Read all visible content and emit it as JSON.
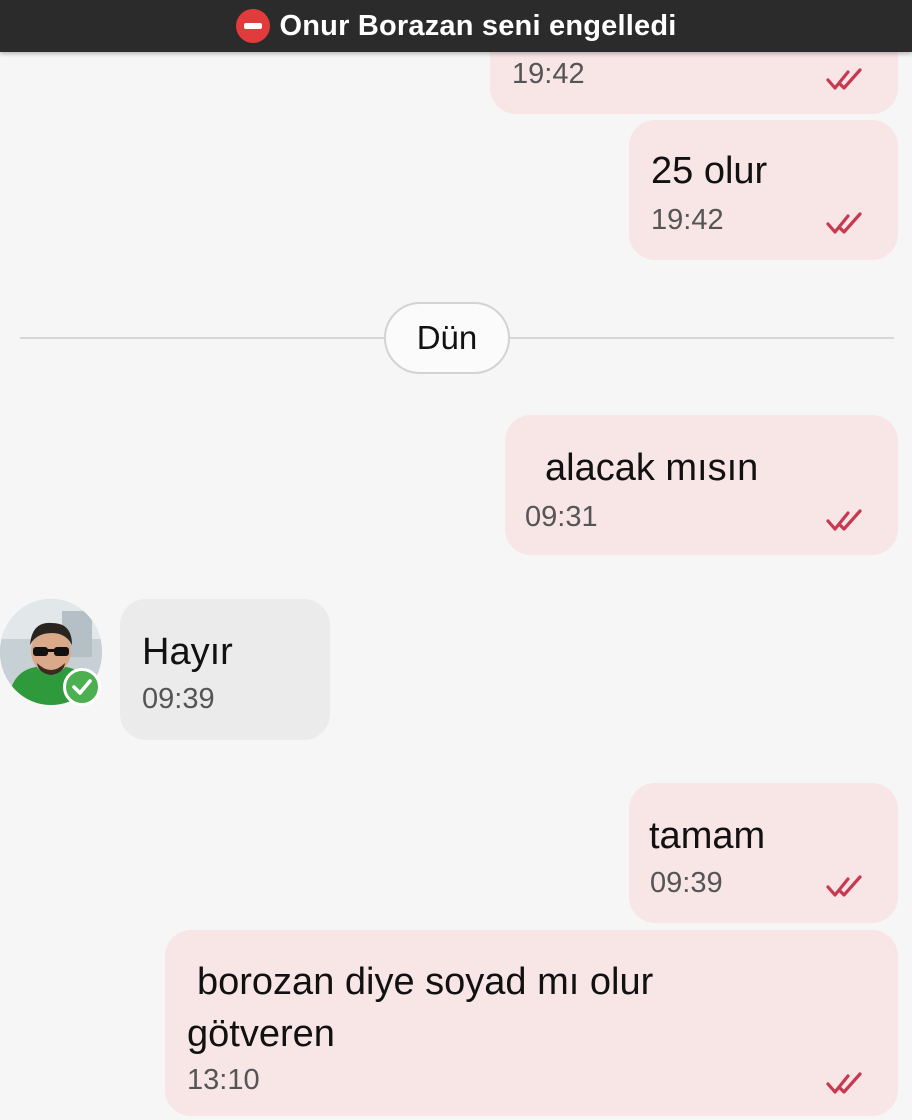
{
  "banner": {
    "icon": "blocked-icon",
    "text": "Onur Borazan seni engelledi"
  },
  "conversation": {
    "messages_before": [
      {
        "direction": "outgoing",
        "text": "",
        "time": "19:42",
        "status": "read"
      },
      {
        "direction": "outgoing",
        "text": "25 olur",
        "time": "19:42",
        "status": "read"
      }
    ],
    "date_separator": "Dün",
    "messages_after": [
      {
        "direction": "outgoing",
        "text": "alacak mısın",
        "time": "09:31",
        "status": "read"
      },
      {
        "direction": "incoming",
        "text": "Hayır",
        "time": "09:39",
        "verified": true
      },
      {
        "direction": "outgoing",
        "text": "tamam",
        "time": "09:39",
        "status": "read"
      },
      {
        "direction": "outgoing",
        "text": "borozan diye soyad mı olur götveren",
        "time": "13:10",
        "status": "read"
      }
    ]
  },
  "icons": {
    "read_receipt": "double-check-icon",
    "verified": "verified-check-icon"
  },
  "colors": {
    "outgoing_bubble": "#f8e5e6",
    "incoming_bubble": "#ebebeb",
    "read_tick": "#c8394f",
    "banner_background": "#2b2b2b",
    "block_icon": "#e23b3b",
    "verified_badge": "#4caf50"
  }
}
